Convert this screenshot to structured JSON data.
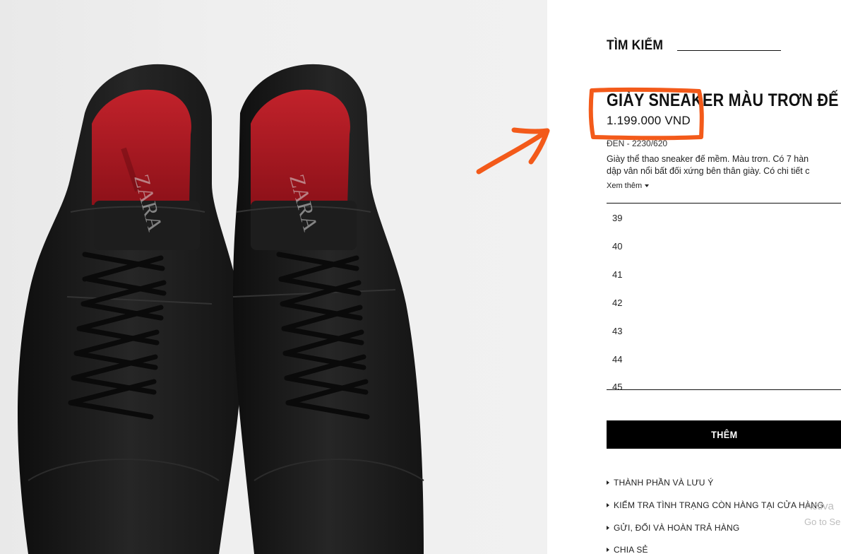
{
  "search": {
    "label": "TÌM KIẾM"
  },
  "product": {
    "title": "GIÀY SNEAKER MÀU TRƠN ĐẾ",
    "price": "1.199.000 VND",
    "color_ref": "ĐEN - 2230/620",
    "description_lines": [
      "Giày thể thao sneaker đế mềm. Màu trơn. Có 7 hàn",
      "dập vân nổi bất đối xứng bên thân giày. Có chi tiết c"
    ],
    "more_label": "Xem thêm"
  },
  "sizes": [
    "39",
    "40",
    "41",
    "42",
    "43",
    "44",
    "45"
  ],
  "add_button": {
    "label": "THÊM"
  },
  "info_links": [
    "THÀNH PHẦN VÀ LƯU Ý",
    "KIỂM TRA TÌNH TRẠNG CÒN HÀNG TẠI CỬA HÀNG",
    "GỬI, ĐỔI VÀ HOÀN TRẢ HÀNG",
    "CHIA SẺ"
  ],
  "watermark": {
    "line1": "Activa",
    "line2": "Go to Se"
  },
  "shoe_brand": "ZARA",
  "colors": {
    "annotation": "#f35a1a",
    "button_bg": "#000000",
    "background_photo": "#ececec",
    "shoe": "#1a1a1a",
    "insole": "#b51d25"
  },
  "icons": {
    "more": "caret-down-icon",
    "links": "triangle-right-icon",
    "annotation": "arrow-annotation-icon"
  }
}
